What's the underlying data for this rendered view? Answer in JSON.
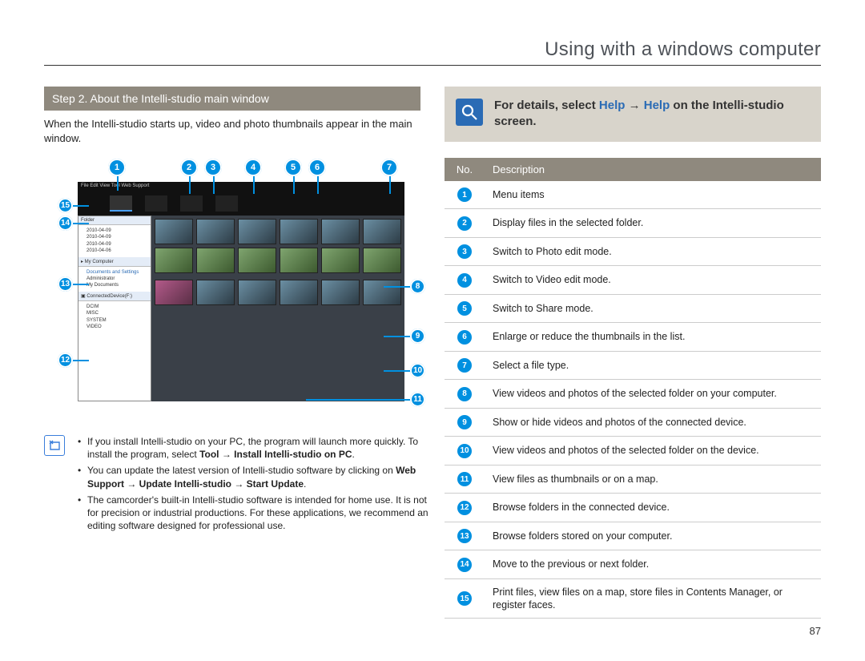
{
  "page_title": "Using with a windows computer",
  "page_number": "87",
  "step_bar": "Step 2. About the Intelli-studio main window",
  "intro": "When the Intelli-studio starts up, video and photo thumbnails appear in the main window.",
  "help_banner": {
    "prefix": "For details, select ",
    "link1": "Help",
    "arrow": " → ",
    "link2": "Help",
    "suffix": " on the Intelli-studio screen."
  },
  "notes": {
    "n1_a": "If you install Intelli-studio on your PC, the program will launch more quickly. To install the program, select ",
    "n1_b": "Tool → Install Intelli-studio on PC",
    "n1_c": ".",
    "n2_a": "You can update the latest version of Intelli-studio software by clicking on ",
    "n2_b": "Web Support  → Update Intelli-studio → Start Update",
    "n2_c": ".",
    "n3": "The camcorder's built-in Intelli-studio software is intended for home use. It is not for precision or industrial productions. For these applications, we recommend an editing software designed for professional use."
  },
  "table": {
    "head_no": "No.",
    "head_desc": "Description",
    "rows": [
      {
        "n": "1",
        "d": "Menu items"
      },
      {
        "n": "2",
        "d": "Display files in the selected folder."
      },
      {
        "n": "3",
        "d": "Switch to Photo edit mode."
      },
      {
        "n": "4",
        "d": "Switch to Video edit mode."
      },
      {
        "n": "5",
        "d": "Switch to Share mode."
      },
      {
        "n": "6",
        "d": "Enlarge or reduce the thumbnails in the list."
      },
      {
        "n": "7",
        "d": "Select a file type."
      },
      {
        "n": "8",
        "d": "View videos and photos of the selected folder on your computer."
      },
      {
        "n": "9",
        "d": "Show or hide videos and photos of the connected device."
      },
      {
        "n": "10",
        "d": "View videos and photos of the selected folder on the device."
      },
      {
        "n": "11",
        "d": "View files as thumbnails or on a map."
      },
      {
        "n": "12",
        "d": "Browse folders in the connected device."
      },
      {
        "n": "13",
        "d": "Browse folders stored on your computer."
      },
      {
        "n": "14",
        "d": "Move to the previous or next folder."
      },
      {
        "n": "15",
        "d": "Print files, view files on a map, store files in Contents Manager, or register faces."
      }
    ]
  },
  "callouts": {
    "c1": "1",
    "c2": "2",
    "c3": "3",
    "c4": "4",
    "c5": "5",
    "c6": "6",
    "c7": "7",
    "c8": "8",
    "c9": "9",
    "c10": "10",
    "c11": "11",
    "c12": "12",
    "c13": "13",
    "c14": "14",
    "c15": "15"
  }
}
